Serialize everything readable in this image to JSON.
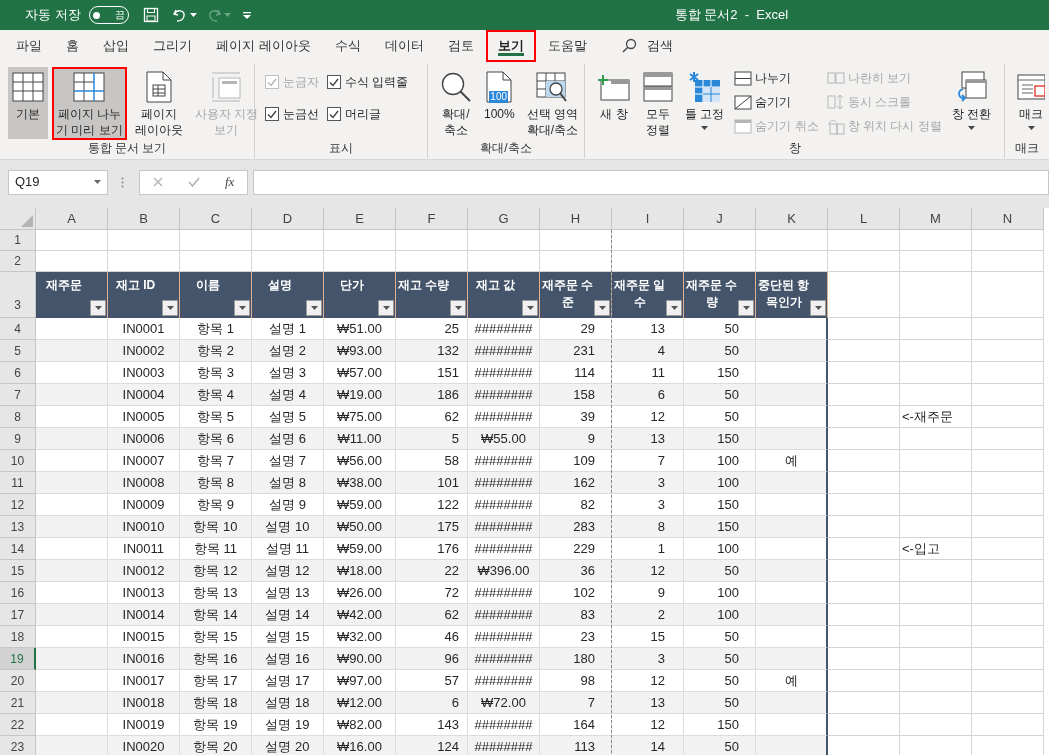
{
  "title_bar": {
    "autosave": {
      "label": "자동 저장",
      "state_text": "끔",
      "on": false
    },
    "redo": {
      "disabled": true
    },
    "title": "통합 문서2  -  Excel"
  },
  "tabs": [
    {
      "label": "파일",
      "selected": false,
      "highlighted": false
    },
    {
      "label": "홈",
      "selected": false,
      "highlighted": false
    },
    {
      "label": "삽입",
      "selected": false,
      "highlighted": false
    },
    {
      "label": "그리기",
      "selected": false,
      "highlighted": false
    },
    {
      "label": "페이지 레이아웃",
      "selected": false,
      "highlighted": false
    },
    {
      "label": "수식",
      "selected": false,
      "highlighted": false
    },
    {
      "label": "데이터",
      "selected": false,
      "highlighted": false
    },
    {
      "label": "검토",
      "selected": false,
      "highlighted": false
    },
    {
      "label": "보기",
      "selected": true,
      "highlighted": true
    },
    {
      "label": "도움말",
      "selected": false,
      "highlighted": false
    }
  ],
  "search": {
    "label": "검색"
  },
  "ribbon": {
    "groups": [
      {
        "label": "통합 문서 보기",
        "items": [
          {
            "kind": "large",
            "label": "기본",
            "selected": true,
            "disabled": false,
            "highlighted": false
          },
          {
            "kind": "large",
            "label": "페이지 나누\n기 미리 보기",
            "selected": true,
            "disabled": false,
            "highlighted": true
          },
          {
            "kind": "large",
            "label": "페이지\n레이아웃",
            "selected": false,
            "disabled": false,
            "highlighted": false
          },
          {
            "kind": "large",
            "label": "사용자 지정\n보기",
            "selected": false,
            "disabled": true,
            "highlighted": false
          }
        ]
      },
      {
        "label": "표시",
        "items": [
          {
            "kind": "stack",
            "items": [
              {
                "kind": "check",
                "label": "눈금자",
                "checked": true,
                "disabled": true
              },
              {
                "kind": "check",
                "label": "눈금선",
                "checked": true,
                "disabled": false
              }
            ]
          },
          {
            "kind": "stack",
            "items": [
              {
                "kind": "check",
                "label": "수식 입력줄",
                "checked": true,
                "disabled": false
              },
              {
                "kind": "check",
                "label": "머리글",
                "checked": true,
                "disabled": false
              }
            ]
          }
        ]
      },
      {
        "label": "확대/축소",
        "items": [
          {
            "kind": "large",
            "label": "확대/\n축소",
            "selected": false,
            "disabled": false,
            "highlighted": false
          },
          {
            "kind": "large",
            "label": "100%",
            "badge": "100",
            "selected": false,
            "disabled": false,
            "highlighted": false
          },
          {
            "kind": "large",
            "label": "선택 영역\n확대/축소",
            "selected": false,
            "disabled": false,
            "highlighted": false
          }
        ]
      },
      {
        "label": "창",
        "items": [
          {
            "kind": "large",
            "label": "새 창",
            "selected": false,
            "disabled": false,
            "highlighted": false
          },
          {
            "kind": "large",
            "label": "모두\n정렬",
            "selected": false,
            "disabled": false,
            "highlighted": false
          },
          {
            "kind": "large",
            "label": "틀 고정",
            "dropdown": true,
            "selected": false,
            "disabled": false,
            "highlighted": false
          },
          {
            "kind": "stack",
            "items": [
              {
                "kind": "command",
                "label": "나누기",
                "disabled": false
              },
              {
                "kind": "command",
                "label": "숨기기",
                "disabled": false
              },
              {
                "kind": "command",
                "label": "숨기기 취소",
                "disabled": true
              }
            ]
          },
          {
            "kind": "stack",
            "items": [
              {
                "kind": "command",
                "label": "나란히 보기",
                "disabled": true
              },
              {
                "kind": "command",
                "label": "동시 스크롤",
                "disabled": true
              },
              {
                "kind": "command",
                "label": "창 위치 다시 정렬",
                "disabled": true
              }
            ]
          },
          {
            "kind": "large",
            "label": "창 전환",
            "dropdown": true,
            "selected": false,
            "disabled": false,
            "highlighted": false
          }
        ]
      },
      {
        "label": "매크",
        "items": [
          {
            "kind": "large",
            "label": "매크",
            "dropdown": true,
            "selected": false,
            "disabled": false,
            "highlighted": false
          }
        ]
      }
    ]
  },
  "formula_bar": {
    "name_box": "Q19",
    "function_label": "fx"
  },
  "sheet": {
    "columns": [
      "A",
      "B",
      "C",
      "D",
      "E",
      "F",
      "G",
      "H",
      "I",
      "J",
      "K",
      "L",
      "M",
      "N"
    ],
    "row_numbers": [
      {
        "label": "1",
        "selected": false
      },
      {
        "label": "2",
        "selected": false
      },
      {
        "label": "3",
        "selected": false
      },
      {
        "label": "4",
        "selected": false
      },
      {
        "label": "5",
        "selected": false
      },
      {
        "label": "6",
        "selected": false
      },
      {
        "label": "7",
        "selected": false
      },
      {
        "label": "8",
        "selected": false
      },
      {
        "label": "9",
        "selected": false
      },
      {
        "label": "10",
        "selected": false
      },
      {
        "label": "11",
        "selected": false
      },
      {
        "label": "12",
        "selected": false
      },
      {
        "label": "13",
        "selected": false
      },
      {
        "label": "14",
        "selected": false
      },
      {
        "label": "15",
        "selected": false
      },
      {
        "label": "16",
        "selected": false
      },
      {
        "label": "17",
        "selected": false
      },
      {
        "label": "18",
        "selected": false
      },
      {
        "label": "19",
        "selected": true
      },
      {
        "label": "20",
        "selected": false
      },
      {
        "label": "21",
        "selected": false
      },
      {
        "label": "22",
        "selected": false
      },
      {
        "label": "23",
        "selected": false
      }
    ],
    "table": {
      "headers": [
        "재주문",
        "재고 ID",
        "이름",
        "설명",
        "단가",
        "재고 수량",
        "재고 값",
        "재주문 수\n준",
        "재주문 일\n수",
        "재주문 수\n량",
        "중단된 항\n목인가"
      ],
      "rows": [
        {
          "id": "IN0001",
          "name": "항목 1",
          "desc": "설명 1",
          "price": "₩51.00",
          "qty": "25",
          "value": "########",
          "level": "29",
          "days": "13",
          "reorder_qty": "50"
        },
        {
          "id": "IN0002",
          "name": "항목 2",
          "desc": "설명 2",
          "price": "₩93.00",
          "qty": "132",
          "value": "########",
          "level": "231",
          "days": "4",
          "reorder_qty": "50"
        },
        {
          "id": "IN0003",
          "name": "항목 3",
          "desc": "설명 3",
          "price": "₩57.00",
          "qty": "151",
          "value": "########",
          "level": "114",
          "days": "11",
          "reorder_qty": "150"
        },
        {
          "id": "IN0004",
          "name": "항목 4",
          "desc": "설명 4",
          "price": "₩19.00",
          "qty": "186",
          "value": "########",
          "level": "158",
          "days": "6",
          "reorder_qty": "50"
        },
        {
          "id": "IN0005",
          "name": "항목 5",
          "desc": "설명 5",
          "price": "₩75.00",
          "qty": "62",
          "value": "########",
          "level": "39",
          "days": "12",
          "reorder_qty": "50",
          "note": "<-재주문"
        },
        {
          "id": "IN0006",
          "name": "항목 6",
          "desc": "설명 6",
          "price": "₩11.00",
          "qty": "5",
          "value": "₩55.00",
          "level": "9",
          "days": "13",
          "reorder_qty": "150"
        },
        {
          "id": "IN0007",
          "name": "항목 7",
          "desc": "설명 7",
          "price": "₩56.00",
          "qty": "58",
          "value": "########",
          "level": "109",
          "days": "7",
          "reorder_qty": "100",
          "discontinued": "예"
        },
        {
          "id": "IN0008",
          "name": "항목 8",
          "desc": "설명 8",
          "price": "₩38.00",
          "qty": "101",
          "value": "########",
          "level": "162",
          "days": "3",
          "reorder_qty": "100"
        },
        {
          "id": "IN0009",
          "name": "항목 9",
          "desc": "설명 9",
          "price": "₩59.00",
          "qty": "122",
          "value": "########",
          "level": "82",
          "days": "3",
          "reorder_qty": "150"
        },
        {
          "id": "IN0010",
          "name": "항목 10",
          "desc": "설명 10",
          "price": "₩50.00",
          "qty": "175",
          "value": "########",
          "level": "283",
          "days": "8",
          "reorder_qty": "150"
        },
        {
          "id": "IN0011",
          "name": "항목 11",
          "desc": "설명 11",
          "price": "₩59.00",
          "qty": "176",
          "value": "########",
          "level": "229",
          "days": "1",
          "reorder_qty": "100",
          "note": "<-입고"
        },
        {
          "id": "IN0012",
          "name": "항목 12",
          "desc": "설명 12",
          "price": "₩18.00",
          "qty": "22",
          "value": "₩396.00",
          "level": "36",
          "days": "12",
          "reorder_qty": "50"
        },
        {
          "id": "IN0013",
          "name": "항목 13",
          "desc": "설명 13",
          "price": "₩26.00",
          "qty": "72",
          "value": "########",
          "level": "102",
          "days": "9",
          "reorder_qty": "100"
        },
        {
          "id": "IN0014",
          "name": "항목 14",
          "desc": "설명 14",
          "price": "₩42.00",
          "qty": "62",
          "value": "########",
          "level": "83",
          "days": "2",
          "reorder_qty": "100"
        },
        {
          "id": "IN0015",
          "name": "항목 15",
          "desc": "설명 15",
          "price": "₩32.00",
          "qty": "46",
          "value": "########",
          "level": "23",
          "days": "15",
          "reorder_qty": "50"
        },
        {
          "id": "IN0016",
          "name": "항목 16",
          "desc": "설명 16",
          "price": "₩90.00",
          "qty": "96",
          "value": "########",
          "level": "180",
          "days": "3",
          "reorder_qty": "50"
        },
        {
          "id": "IN0017",
          "name": "항목 17",
          "desc": "설명 17",
          "price": "₩97.00",
          "qty": "57",
          "value": "########",
          "level": "98",
          "days": "12",
          "reorder_qty": "50",
          "discontinued": "예"
        },
        {
          "id": "IN0018",
          "name": "항목 18",
          "desc": "설명 18",
          "price": "₩12.00",
          "qty": "6",
          "value": "₩72.00",
          "level": "7",
          "days": "13",
          "reorder_qty": "50"
        },
        {
          "id": "IN0019",
          "name": "항목 19",
          "desc": "설명 19",
          "price": "₩82.00",
          "qty": "143",
          "value": "########",
          "level": "164",
          "days": "12",
          "reorder_qty": "150"
        },
        {
          "id": "IN0020",
          "name": "항목 20",
          "desc": "설명 20",
          "price": "₩16.00",
          "qty": "124",
          "value": "########",
          "level": "113",
          "days": "14",
          "reorder_qty": "50"
        }
      ]
    }
  }
}
